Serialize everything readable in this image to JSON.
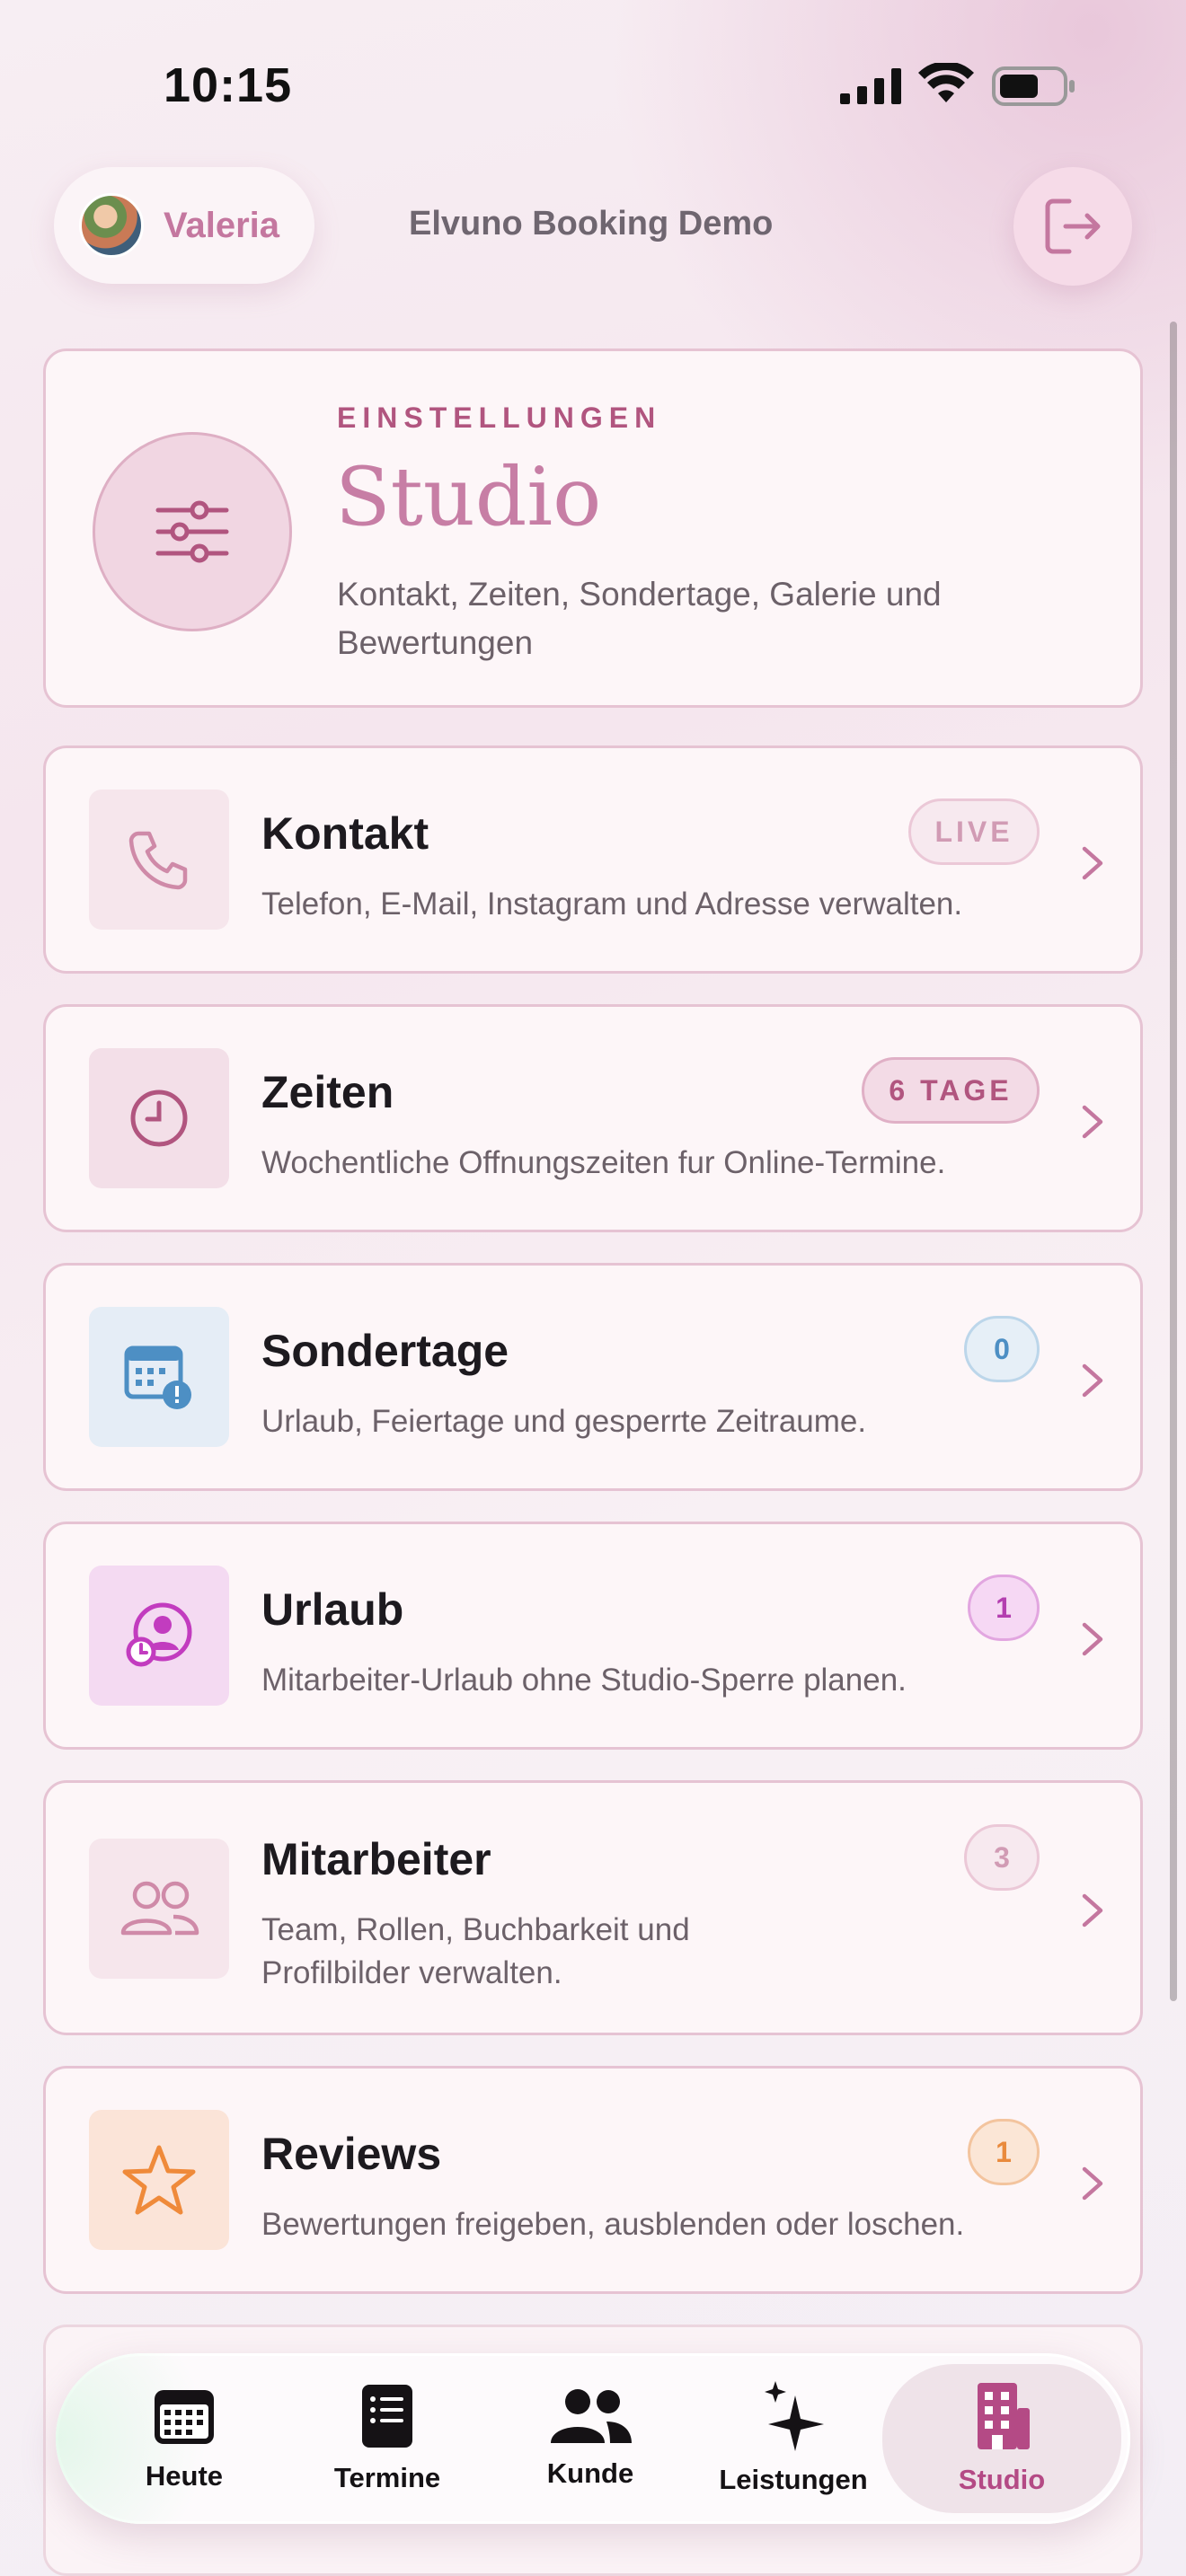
{
  "status_bar": {
    "time": "10:15"
  },
  "header": {
    "profile_name": "Valeria",
    "app_title": "Elvuno Booking Demo"
  },
  "hero": {
    "eyebrow": "EINSTELLUNGEN",
    "title": "Studio",
    "subtitle": "Kontakt, Zeiten, Sondertage, Galerie und Bewertungen"
  },
  "cards": [
    {
      "title": "Kontakt",
      "desc": "Telefon, E-Mail, Instagram und Adresse verwalten.",
      "badge": "LIVE",
      "icon": "phone-icon"
    },
    {
      "title": "Zeiten",
      "desc": "Wochentliche Offnungszeiten fur Online-Termine.",
      "badge": "6 TAGE",
      "icon": "clock-icon"
    },
    {
      "title": "Sondertage",
      "desc": "Urlaub, Feiertage und gesperrte Zeitraume.",
      "badge": "0",
      "icon": "calendar-alert-icon"
    },
    {
      "title": "Urlaub",
      "desc": "Mitarbeiter-Urlaub ohne Studio-Sperre planen.",
      "badge": "1",
      "icon": "person-clock-icon"
    },
    {
      "title": "Mitarbeiter",
      "desc": "Team, Rollen, Buchbarkeit und Profilbilder verwalten.",
      "badge": "3",
      "icon": "people-icon"
    },
    {
      "title": "Reviews",
      "desc": "Bewertungen freigeben, ausblenden oder loschen.",
      "badge": "1",
      "icon": "star-icon"
    }
  ],
  "tabs": [
    {
      "label": "Heute",
      "icon": "calendar-grid-icon"
    },
    {
      "label": "Termine",
      "icon": "list-icon"
    },
    {
      "label": "Kunde",
      "icon": "people-icon"
    },
    {
      "label": "Leistungen",
      "icon": "sparkle-icon"
    },
    {
      "label": "Studio",
      "icon": "building-icon",
      "active": true
    }
  ],
  "colors": {
    "accent": "#c4779f",
    "accent_dark": "#b1557f",
    "card_border": "#e6c3d3"
  }
}
